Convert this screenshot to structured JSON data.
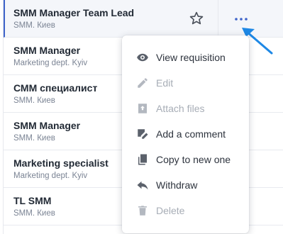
{
  "requisitions": [
    {
      "title": "SMM Manager Team Lead",
      "subtitle": "SMM. Киев"
    },
    {
      "title": "SMM Manager",
      "subtitle": "Marketing dept. Kyiv"
    },
    {
      "title": "СММ специалист",
      "subtitle": "SMM. Киев"
    },
    {
      "title": "SMM Manager",
      "subtitle": "SMM. Киев"
    },
    {
      "title": "Marketing specialist",
      "subtitle": "Marketing dept. Kyiv"
    },
    {
      "title": "TL SMM",
      "subtitle": "SMM. Киев"
    }
  ],
  "menu": {
    "items": [
      {
        "label": "View requisition",
        "icon": "eye-icon",
        "enabled": true
      },
      {
        "label": "Edit",
        "icon": "pencil-icon",
        "enabled": false
      },
      {
        "label": "Attach files",
        "icon": "upload-file-icon",
        "enabled": false
      },
      {
        "label": "Add a comment",
        "icon": "comment-edit-icon",
        "enabled": true
      },
      {
        "label": "Copy to new one",
        "icon": "copy-icon",
        "enabled": true
      },
      {
        "label": "Withdraw",
        "icon": "reply-arrow-icon",
        "enabled": true
      },
      {
        "label": "Delete",
        "icon": "trash-icon",
        "enabled": false
      }
    ]
  },
  "colors": {
    "accent": "#3d63c9",
    "annotation_arrow": "#1e88e5",
    "icon_enabled": "#5b616b",
    "icon_disabled": "#b3b8c0"
  }
}
